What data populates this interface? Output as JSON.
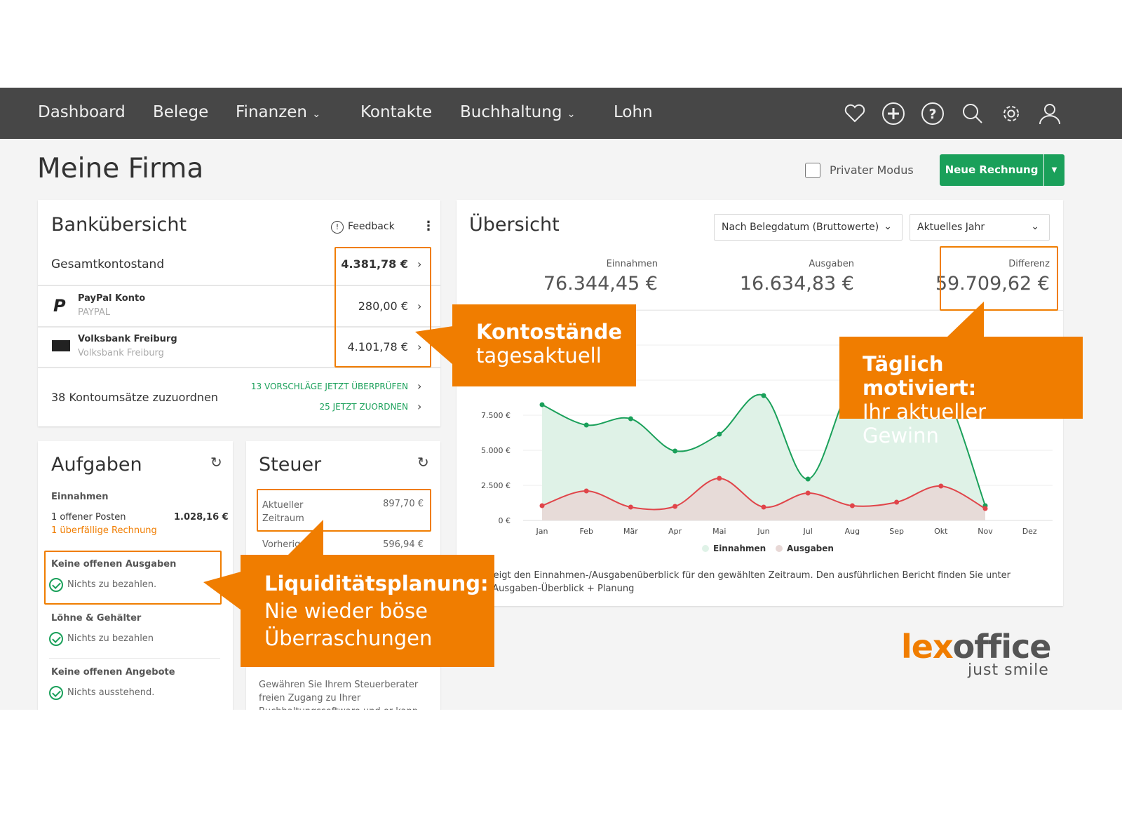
{
  "nav": {
    "items": [
      "Dashboard",
      "Belege",
      "Finanzen",
      "Kontakte",
      "Buchhaltung",
      "Lohn"
    ],
    "icons": [
      "heart-icon",
      "plus-circle-icon",
      "help-icon",
      "search-icon",
      "gear-icon",
      "user-icon"
    ]
  },
  "page": {
    "title": "Meine Firma",
    "private_mode": "Privater Modus",
    "new_invoice": "Neue Rechnung"
  },
  "bank": {
    "title": "Bankübersicht",
    "feedback": "Feedback",
    "total_label": "Gesamtkontostand",
    "total_value": "4.381,78 €",
    "accounts": [
      {
        "name": "PayPal Konto",
        "sub": "PAYPAL",
        "value": "280,00 €"
      },
      {
        "name": "Volksbank Freiburg",
        "sub": "Volksbank Freiburg",
        "value": "4.101,78 €"
      }
    ],
    "assign_label": "38 Kontoumsätze zuzuordnen",
    "link1": "13 VORSCHLÄGE JETZT ÜBERPRÜFEN",
    "link2": "25 JETZT ZUORDNEN"
  },
  "tasks": {
    "title": "Aufgaben",
    "income_head": "Einnahmen",
    "open_items": "1  offener Posten",
    "open_value": "1.028,16 €",
    "overdue": "1  überfällige Rechnung",
    "groups": [
      {
        "head": "Keine offenen Ausgaben",
        "text": "Nichts zu bezahlen."
      },
      {
        "head": "Löhne & Gehälter",
        "text": "Nichts zu bezahlen"
      },
      {
        "head": "Keine offenen Angebote",
        "text": "Nichts ausstehend."
      }
    ]
  },
  "tax": {
    "title": "Steuer",
    "current_label": "Aktueller Zeitraum",
    "current_value": "897,70 €",
    "prev_label": "Vorherig",
    "prev_value": "596,94 €",
    "text": "Gewähren Sie Ihrem Steuerberater freien Zugang zu Ihrer Buchhaltungssoftware und er kann Sie"
  },
  "overview": {
    "title": "Übersicht",
    "filter1": "Nach Belegdatum (Bruttowerte)",
    "filter2": "Aktuelles Jahr",
    "kpis": [
      {
        "label": "Einnahmen",
        "value": "76.344,45 €"
      },
      {
        "label": "Ausgaben",
        "value": "16.634,83 €"
      },
      {
        "label": "Differenz",
        "value": "59.709,62 €"
      }
    ],
    "note1": "afik zeigt den Einnahmen-/Ausgabenüberblick für den gewählten Zeitraum. Den ausführlichen Bericht finden Sie unter",
    "note2": "men/Ausgaben-Überblick + Planung"
  },
  "chart_data": {
    "type": "area",
    "categories": [
      "Jan",
      "Feb",
      "Mär",
      "Apr",
      "Mai",
      "Jun",
      "Jul",
      "Aug",
      "Sep",
      "Okt",
      "Nov",
      "Dez"
    ],
    "ylim": [
      0,
      15000
    ],
    "yticks": [
      "0 €",
      "2.500 €",
      "5.000 €",
      "7.500 €",
      "10.000 €",
      "12.500 €",
      "15.000 €"
    ],
    "grid": true,
    "legend": "bottom",
    "series": [
      {
        "name": "Einnahmen",
        "color": "#1aa05a",
        "fill": "#dff2e7",
        "values": [
          8250,
          6800,
          7250,
          4950,
          6150,
          8900,
          2950,
          9800,
          10500,
          9750,
          1050
        ]
      },
      {
        "name": "Ausgaben",
        "color": "#e0454a",
        "fill": "#e8d8d6",
        "values": [
          1050,
          2100,
          950,
          1000,
          3000,
          950,
          1950,
          1050,
          1300,
          2450,
          850
        ]
      }
    ]
  },
  "callouts": {
    "c1_bold": "Kontostände",
    "c1_text": "tagesaktuell",
    "c2_bold": "Täglich motiviert:",
    "c2_text": "Ihr aktueller Gewinn",
    "c3_bold": "Liquiditätsplanung:",
    "c3_text1": "Nie wieder böse",
    "c3_text2": "Überraschungen"
  },
  "brand": {
    "logo": "lexoffice",
    "tagline": "just smile"
  },
  "colors": {
    "accent": "#f07d00",
    "green": "#1aa05a",
    "nav": "#474747"
  }
}
